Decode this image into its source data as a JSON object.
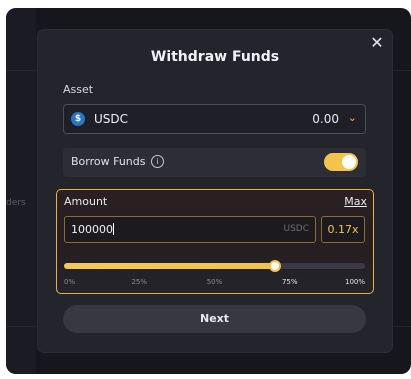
{
  "background": {
    "edge_text": "ders"
  },
  "modal": {
    "title": "Withdraw Funds",
    "close_icon": "close-icon",
    "asset": {
      "label": "Asset",
      "selected": "USDC",
      "icon": "usdc-icon",
      "balance": "0.00"
    },
    "borrow": {
      "label": "Borrow Funds",
      "enabled": true,
      "info_icon": "info-icon",
      "info_glyph": "i"
    },
    "amount": {
      "label": "Amount",
      "max_label": "Max",
      "value": "100000",
      "unit": "USDC",
      "leverage": "0.17x",
      "slider_percent": 70,
      "ticks": [
        "0%",
        "25%",
        "50%",
        "75%",
        "100%"
      ]
    },
    "next_label": "Next"
  },
  "colors": {
    "accent": "#f3c44d",
    "modal_bg": "#24242d",
    "usdc_blue": "#2775ca"
  }
}
